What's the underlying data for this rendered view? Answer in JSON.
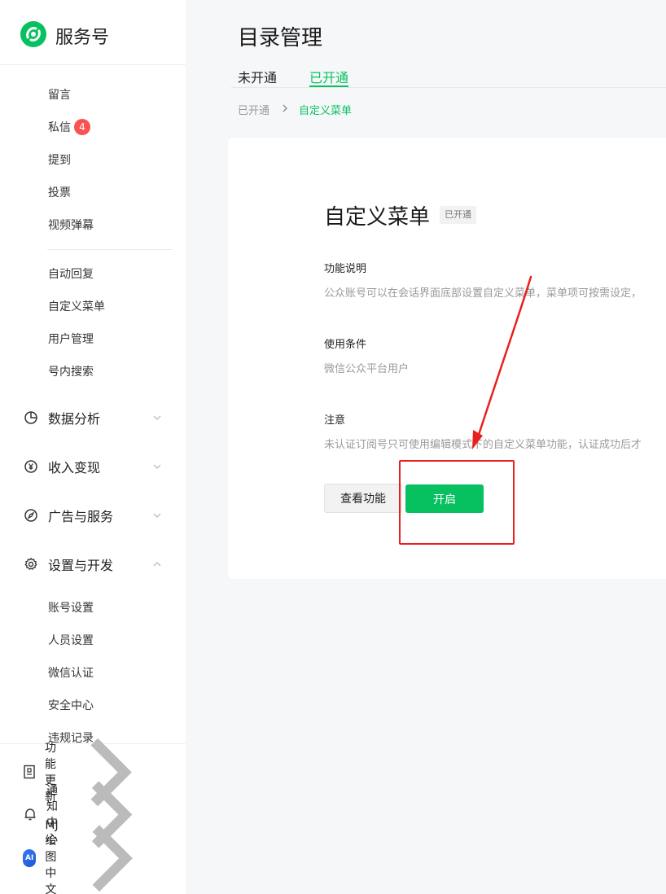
{
  "app": {
    "name": "服务号",
    "brand_color": "#07c160",
    "badge_color": "#fa5151"
  },
  "sidebar": {
    "sub_items_top": [
      {
        "label": "留言"
      },
      {
        "label": "私信",
        "badge": "4"
      },
      {
        "label": "提到"
      },
      {
        "label": "投票"
      },
      {
        "label": "视频弹幕"
      }
    ],
    "sub_items_mid": [
      {
        "label": "自动回复"
      },
      {
        "label": "自定义菜单"
      },
      {
        "label": "用户管理"
      },
      {
        "label": "号内搜索"
      }
    ],
    "groups": [
      {
        "label": "数据分析",
        "icon": "pie-chart-icon",
        "expanded": false
      },
      {
        "label": "收入变现",
        "icon": "yuan-circle-icon",
        "expanded": false
      },
      {
        "label": "广告与服务",
        "icon": "compass-icon",
        "expanded": false
      },
      {
        "label": "设置与开发",
        "icon": "gear-icon",
        "expanded": true
      }
    ],
    "settings_items": [
      {
        "label": "账号设置"
      },
      {
        "label": "人员设置"
      },
      {
        "label": "微信认证"
      },
      {
        "label": "安全中心"
      },
      {
        "label": "违规记录"
      }
    ],
    "bottom": [
      {
        "label": "功能更新",
        "icon": "book-icon"
      },
      {
        "label": "通知中心",
        "icon": "bell-icon"
      },
      {
        "label": "MJ绘图中文",
        "icon": "account-avatar",
        "avatar_text": "AI"
      }
    ]
  },
  "main": {
    "title": "目录管理",
    "tabs": [
      {
        "label": "未开通",
        "active": false
      },
      {
        "label": "已开通",
        "active": true
      }
    ],
    "breadcrumb": [
      "已开通",
      "自定义菜单"
    ],
    "card": {
      "title": "自定义菜单",
      "status": "已开通",
      "sections": [
        {
          "title": "功能说明",
          "desc": "公众账号可以在会话界面底部设置自定义菜单，菜单项可按需设定，"
        },
        {
          "title": "使用条件",
          "desc": "微信公众平台用户"
        },
        {
          "title": "注意",
          "desc": "未认证订阅号只可使用编辑模式下的自定义菜单功能，认证成功后才"
        }
      ],
      "buttons": {
        "view": "查看功能",
        "open": "开启"
      }
    }
  },
  "annotation": {
    "color": "#e8201f"
  }
}
